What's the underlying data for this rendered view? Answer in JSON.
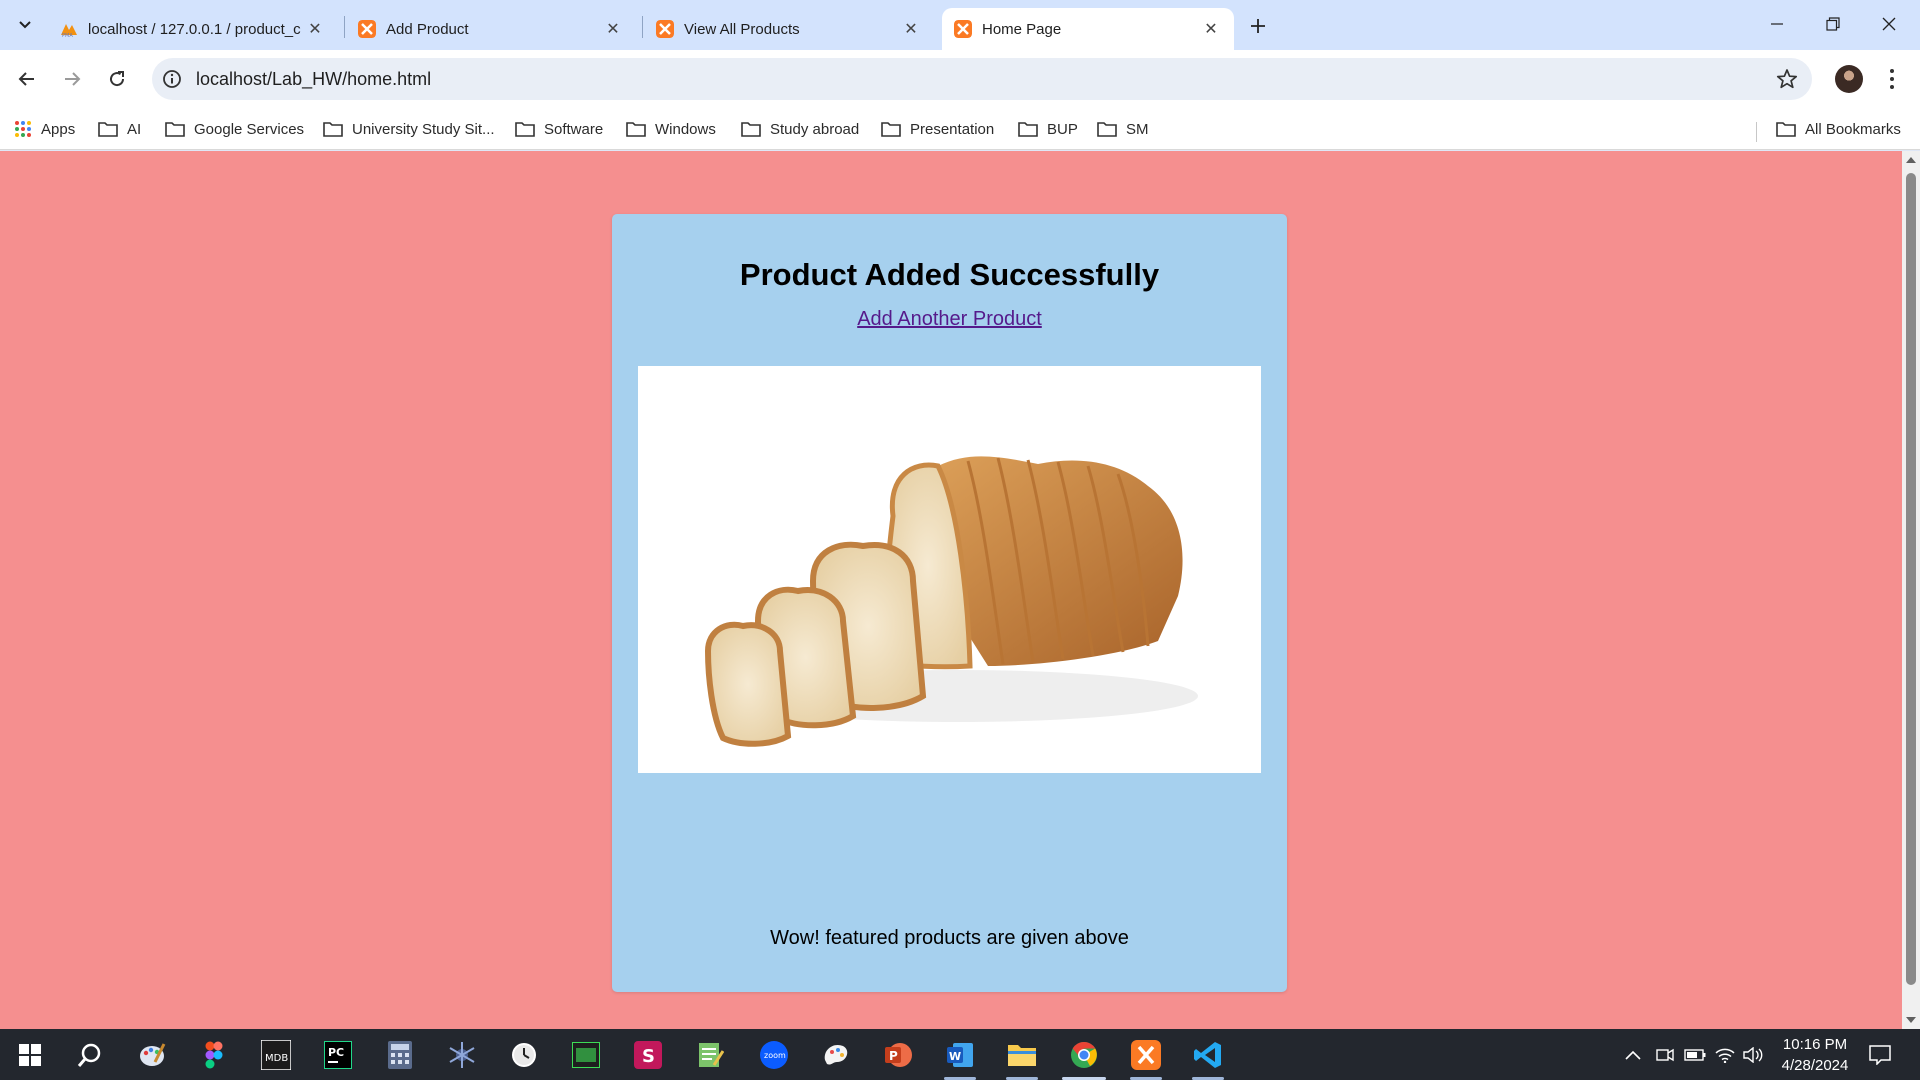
{
  "browser": {
    "tabs": [
      {
        "label": "localhost / 127.0.0.1 / product_c",
        "favicon": "phpmyadmin-icon",
        "active": false
      },
      {
        "label": "Add Product",
        "favicon": "xampp-icon",
        "active": false
      },
      {
        "label": "View All Products",
        "favicon": "xampp-icon",
        "active": false
      },
      {
        "label": "Home Page",
        "favicon": "xampp-icon",
        "active": true
      }
    ],
    "url": "localhost/Lab_HW/home.html",
    "bookmarks": [
      {
        "label": "Apps",
        "icon": "apps-grid-icon"
      },
      {
        "label": "AI",
        "icon": "folder-icon"
      },
      {
        "label": "Google Services",
        "icon": "folder-icon"
      },
      {
        "label": "University Study Sit...",
        "icon": "folder-icon"
      },
      {
        "label": "Software",
        "icon": "folder-icon"
      },
      {
        "label": "Windows",
        "icon": "folder-icon"
      },
      {
        "label": "Study abroad",
        "icon": "folder-icon"
      },
      {
        "label": "Presentation",
        "icon": "folder-icon"
      },
      {
        "label": "BUP",
        "icon": "folder-icon"
      },
      {
        "label": "SM",
        "icon": "folder-icon"
      }
    ],
    "all_bookmarks": "All Bookmarks"
  },
  "page": {
    "background": "#f58f8f",
    "card_background": "#a6d0ee",
    "heading": "Product Added Successfully",
    "link_label": "Add Another Product",
    "image_subject": "sliced-bread-loaf",
    "caption": "Wow! featured products are given above"
  },
  "taskbar": {
    "apps": [
      "start",
      "search",
      "paint",
      "figma",
      "mdb",
      "pycharm",
      "calculator",
      "network",
      "clock",
      "terminal",
      "slides",
      "notepad",
      "zoom",
      "paint3d",
      "powerpoint",
      "word",
      "file-explorer",
      "chrome",
      "xampp",
      "vscode"
    ],
    "time": "10:16 PM",
    "date": "4/28/2024"
  }
}
